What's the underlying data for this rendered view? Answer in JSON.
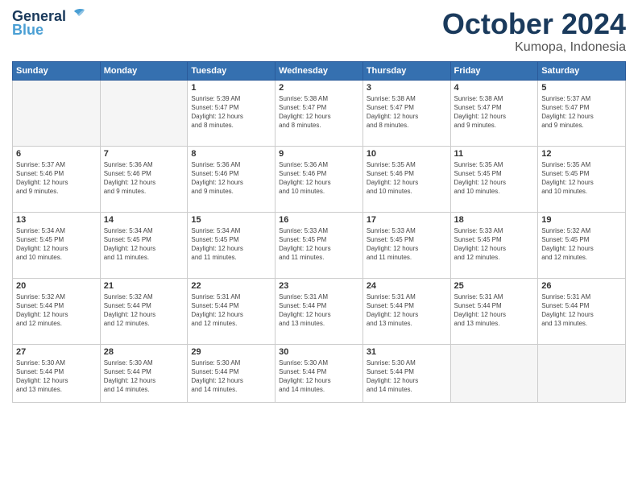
{
  "header": {
    "logo_general": "General",
    "logo_blue": "Blue",
    "month": "October 2024",
    "location": "Kumopa, Indonesia"
  },
  "weekdays": [
    "Sunday",
    "Monday",
    "Tuesday",
    "Wednesday",
    "Thursday",
    "Friday",
    "Saturday"
  ],
  "weeks": [
    [
      {
        "day": "",
        "info": ""
      },
      {
        "day": "",
        "info": ""
      },
      {
        "day": "1",
        "info": "Sunrise: 5:39 AM\nSunset: 5:47 PM\nDaylight: 12 hours\nand 8 minutes."
      },
      {
        "day": "2",
        "info": "Sunrise: 5:38 AM\nSunset: 5:47 PM\nDaylight: 12 hours\nand 8 minutes."
      },
      {
        "day": "3",
        "info": "Sunrise: 5:38 AM\nSunset: 5:47 PM\nDaylight: 12 hours\nand 8 minutes."
      },
      {
        "day": "4",
        "info": "Sunrise: 5:38 AM\nSunset: 5:47 PM\nDaylight: 12 hours\nand 9 minutes."
      },
      {
        "day": "5",
        "info": "Sunrise: 5:37 AM\nSunset: 5:47 PM\nDaylight: 12 hours\nand 9 minutes."
      }
    ],
    [
      {
        "day": "6",
        "info": "Sunrise: 5:37 AM\nSunset: 5:46 PM\nDaylight: 12 hours\nand 9 minutes."
      },
      {
        "day": "7",
        "info": "Sunrise: 5:36 AM\nSunset: 5:46 PM\nDaylight: 12 hours\nand 9 minutes."
      },
      {
        "day": "8",
        "info": "Sunrise: 5:36 AM\nSunset: 5:46 PM\nDaylight: 12 hours\nand 9 minutes."
      },
      {
        "day": "9",
        "info": "Sunrise: 5:36 AM\nSunset: 5:46 PM\nDaylight: 12 hours\nand 10 minutes."
      },
      {
        "day": "10",
        "info": "Sunrise: 5:35 AM\nSunset: 5:46 PM\nDaylight: 12 hours\nand 10 minutes."
      },
      {
        "day": "11",
        "info": "Sunrise: 5:35 AM\nSunset: 5:45 PM\nDaylight: 12 hours\nand 10 minutes."
      },
      {
        "day": "12",
        "info": "Sunrise: 5:35 AM\nSunset: 5:45 PM\nDaylight: 12 hours\nand 10 minutes."
      }
    ],
    [
      {
        "day": "13",
        "info": "Sunrise: 5:34 AM\nSunset: 5:45 PM\nDaylight: 12 hours\nand 10 minutes."
      },
      {
        "day": "14",
        "info": "Sunrise: 5:34 AM\nSunset: 5:45 PM\nDaylight: 12 hours\nand 11 minutes."
      },
      {
        "day": "15",
        "info": "Sunrise: 5:34 AM\nSunset: 5:45 PM\nDaylight: 12 hours\nand 11 minutes."
      },
      {
        "day": "16",
        "info": "Sunrise: 5:33 AM\nSunset: 5:45 PM\nDaylight: 12 hours\nand 11 minutes."
      },
      {
        "day": "17",
        "info": "Sunrise: 5:33 AM\nSunset: 5:45 PM\nDaylight: 12 hours\nand 11 minutes."
      },
      {
        "day": "18",
        "info": "Sunrise: 5:33 AM\nSunset: 5:45 PM\nDaylight: 12 hours\nand 12 minutes."
      },
      {
        "day": "19",
        "info": "Sunrise: 5:32 AM\nSunset: 5:45 PM\nDaylight: 12 hours\nand 12 minutes."
      }
    ],
    [
      {
        "day": "20",
        "info": "Sunrise: 5:32 AM\nSunset: 5:44 PM\nDaylight: 12 hours\nand 12 minutes."
      },
      {
        "day": "21",
        "info": "Sunrise: 5:32 AM\nSunset: 5:44 PM\nDaylight: 12 hours\nand 12 minutes."
      },
      {
        "day": "22",
        "info": "Sunrise: 5:31 AM\nSunset: 5:44 PM\nDaylight: 12 hours\nand 12 minutes."
      },
      {
        "day": "23",
        "info": "Sunrise: 5:31 AM\nSunset: 5:44 PM\nDaylight: 12 hours\nand 13 minutes."
      },
      {
        "day": "24",
        "info": "Sunrise: 5:31 AM\nSunset: 5:44 PM\nDaylight: 12 hours\nand 13 minutes."
      },
      {
        "day": "25",
        "info": "Sunrise: 5:31 AM\nSunset: 5:44 PM\nDaylight: 12 hours\nand 13 minutes."
      },
      {
        "day": "26",
        "info": "Sunrise: 5:31 AM\nSunset: 5:44 PM\nDaylight: 12 hours\nand 13 minutes."
      }
    ],
    [
      {
        "day": "27",
        "info": "Sunrise: 5:30 AM\nSunset: 5:44 PM\nDaylight: 12 hours\nand 13 minutes."
      },
      {
        "day": "28",
        "info": "Sunrise: 5:30 AM\nSunset: 5:44 PM\nDaylight: 12 hours\nand 14 minutes."
      },
      {
        "day": "29",
        "info": "Sunrise: 5:30 AM\nSunset: 5:44 PM\nDaylight: 12 hours\nand 14 minutes."
      },
      {
        "day": "30",
        "info": "Sunrise: 5:30 AM\nSunset: 5:44 PM\nDaylight: 12 hours\nand 14 minutes."
      },
      {
        "day": "31",
        "info": "Sunrise: 5:30 AM\nSunset: 5:44 PM\nDaylight: 12 hours\nand 14 minutes."
      },
      {
        "day": "",
        "info": ""
      },
      {
        "day": "",
        "info": ""
      }
    ]
  ]
}
